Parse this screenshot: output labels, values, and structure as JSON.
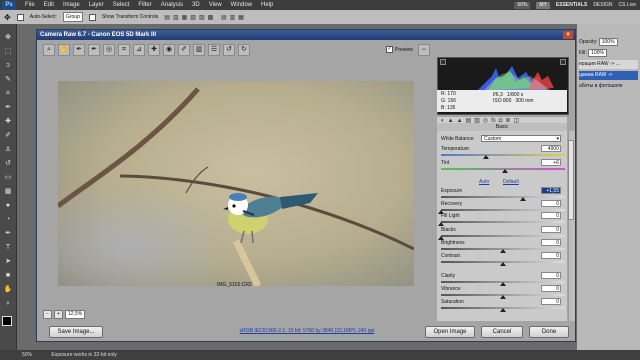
{
  "menubar": {
    "logo": "Ps",
    "items": [
      "File",
      "Edit",
      "Image",
      "Layer",
      "Select",
      "Filter",
      "Analysis",
      "3D",
      "View",
      "Window",
      "Help"
    ],
    "zoom": "50%",
    "my_badge": "MY",
    "workspace_label": "ESSENTIALS",
    "design_label": "DESIGN",
    "cs_live": "CS Live"
  },
  "optionsbar": {
    "auto_select_label": "Auto-Select:",
    "group_value": "Group",
    "show_transform_label": "Show Transform Controls"
  },
  "rightpanel": {
    "opacity_label": "Opacity:",
    "opacity_value": "100%",
    "fill_label": "Fill:",
    "fill_value": "100%",
    "history_lines": [
      "ерация RAW -> ...",
      "цанжа RAW ->",
      "аботы в фотошопе"
    ]
  },
  "statusbar": {
    "zoom": "50%",
    "message": "Exposure works in 32-bit only"
  },
  "dialog": {
    "title": "Camera Raw 6.7  -  Canon EOS 5D Mark III",
    "preview_label": "Preview",
    "preview_checked": true,
    "filename": "IMG_5102.CR2",
    "zoom_value": "12,5%",
    "workflow_link": "sRGB IEC61966-2.1; 16 bit; 5760 by 3840 (22,1MP); 240 ppi",
    "buttons": {
      "save": "Save Image...",
      "open": "Open Image",
      "cancel": "Cancel",
      "done": "Done"
    }
  },
  "readout": {
    "r_label": "R:",
    "r_value": "170",
    "g_label": "G:",
    "g_value": "156",
    "b_label": "B:",
    "b_value": "135",
    "aperture": "f/6,3",
    "shutter": "1/800 s",
    "iso": "ISO 800",
    "focal": "300 mm"
  },
  "basic": {
    "header": "Basic",
    "white_balance_label": "White Balance:",
    "white_balance_value": "Custom",
    "auto_label": "Auto",
    "default_label": "Default",
    "controls": [
      {
        "label": "Temperature",
        "value": "4900",
        "fraction": 0.36
      },
      {
        "label": "Tint",
        "value": "+6",
        "fraction": 0.52
      },
      {
        "label": "Exposure",
        "value": "+1,55",
        "fraction": 0.66
      },
      {
        "label": "Recovery",
        "value": "0",
        "fraction": 0.0
      },
      {
        "label": "Fill Light",
        "value": "0",
        "fraction": 0.0
      },
      {
        "label": "Blacks",
        "value": "0",
        "fraction": 0.0
      },
      {
        "label": "Brightness",
        "value": "0",
        "fraction": 0.5
      },
      {
        "label": "Contrast",
        "value": "0",
        "fraction": 0.5
      },
      {
        "label": "Clarity",
        "value": "0",
        "fraction": 0.5
      },
      {
        "label": "Vibrance",
        "value": "0",
        "fraction": 0.5
      },
      {
        "label": "Saturation",
        "value": "0",
        "fraction": 0.5
      }
    ]
  },
  "colors": {
    "titlebar": "#2c4c88",
    "link": "#1f3fa8",
    "selected_value_bg": "#1d3d8a"
  }
}
